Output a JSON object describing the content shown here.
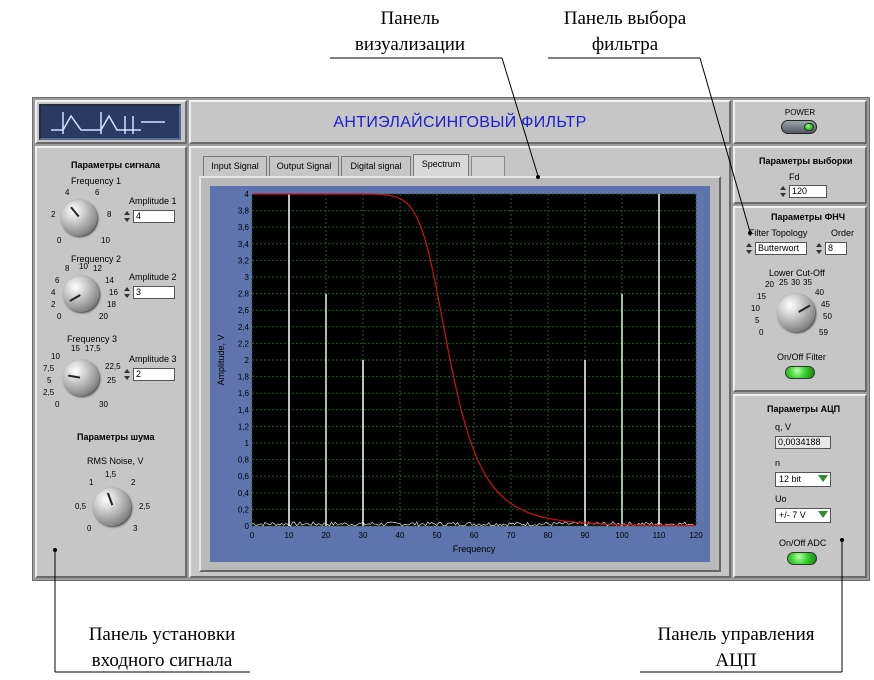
{
  "callouts": {
    "visualization": [
      "Панель",
      "визуализации"
    ],
    "filter_select": [
      "Панель выбора",
      "фильтра"
    ],
    "input_signal": [
      "Панель установки",
      "входного сигнала"
    ],
    "adc_control": [
      "Панель  управления",
      "АЦП"
    ]
  },
  "header": {
    "title": "АНТИЭЛАЙСИНГОВЫЙ ФИЛЬТР",
    "power_label": "POWER"
  },
  "signal_panel": {
    "title": "Параметры  сигнала",
    "freq1": {
      "label": "Frequency 1",
      "ticks": [
        "0",
        "2",
        "4",
        "6",
        "8",
        "10"
      ],
      "amp_label": "Amplitude 1",
      "amp_value": "4"
    },
    "freq2": {
      "label": "Frequency 2",
      "ticks": [
        "0",
        "2",
        "4",
        "6",
        "8",
        "10",
        "12",
        "14",
        "16",
        "18",
        "20"
      ],
      "amp_label": "Amplitude 2",
      "amp_value": "3"
    },
    "freq3": {
      "label": "Frequency 3",
      "ticks": [
        "0",
        "2,5",
        "5",
        "7,5",
        "10",
        "15",
        "17,5",
        "22,5",
        "25",
        "30"
      ],
      "amp_label": "Amplitude 3",
      "amp_value": "2"
    },
    "noise_title": "Параметры шума",
    "noise": {
      "label": "RMS Noise, V",
      "ticks": [
        "0",
        "0,5",
        "1",
        "1,5",
        "2",
        "2,5",
        "3"
      ]
    }
  },
  "tabs": [
    {
      "label": "Input Signal",
      "active": false
    },
    {
      "label": "Output Signal",
      "active": false
    },
    {
      "label": "Digital signal",
      "active": false
    },
    {
      "label": "Spectrum",
      "active": true
    }
  ],
  "chart_data": {
    "type": "line",
    "xlabel": "Frequency",
    "ylabel": "Amplitude, V",
    "xlim": [
      0,
      120
    ],
    "ylim": [
      0,
      4
    ],
    "xticks": [
      0,
      10,
      20,
      30,
      40,
      50,
      60,
      70,
      80,
      90,
      100,
      110,
      120
    ],
    "yticks": [
      0,
      0.2,
      0.4,
      0.6,
      0.8,
      1,
      1.2,
      1.4,
      1.6,
      1.8,
      2,
      2.2,
      2.4,
      2.6,
      2.8,
      3,
      3.2,
      3.4,
      3.6,
      3.8,
      4
    ],
    "ytick_labels": [
      "0",
      "0,2",
      "0,4",
      "0,6",
      "0,8",
      "1",
      "1,2",
      "1,4",
      "1,6",
      "1,8",
      "2",
      "2,2",
      "2,4",
      "2,6",
      "2,8",
      "3",
      "3,2",
      "3,4",
      "3,6",
      "3,8",
      "4"
    ],
    "grid": true,
    "spectrum_lines": [
      {
        "x": 10,
        "y": 4.0,
        "color": "#ffffff"
      },
      {
        "x": 20,
        "y": 2.8,
        "color": "#d8ffd8"
      },
      {
        "x": 30,
        "y": 2.0,
        "color": "#ffffff"
      },
      {
        "x": 90,
        "y": 2.0,
        "color": "#ffffff"
      },
      {
        "x": 100,
        "y": 2.8,
        "color": "#d8ffd8"
      },
      {
        "x": 110,
        "y": 4.0,
        "color": "#ffffff"
      }
    ],
    "filter_curve": {
      "color": "#d01010",
      "level": 4.0,
      "cutoff": 50,
      "order": 8
    },
    "colors": {
      "plot_bg": "#000000",
      "grid": "#1e5e1e",
      "frame": "#5f74ad"
    }
  },
  "sampling_panel": {
    "title": "Параметры выборки",
    "fd_label": "Fd",
    "fd_value": "120"
  },
  "lpf_panel": {
    "title": "Параметры ФНЧ",
    "topology_label": "Filter Topology",
    "topology_value": "Butterwort",
    "order_label": "Order",
    "order_value": "8",
    "cutoff_label": "Lower Cut-Off",
    "cutoff_ticks": [
      "0",
      "5",
      "10",
      "15",
      "20",
      "25",
      "30",
      "35",
      "40",
      "45",
      "50",
      "59"
    ],
    "onoff_label": "On/Off Filter"
  },
  "adc_panel": {
    "title": "Параметры АЦП",
    "q_label": "q, V",
    "q_value": "0,0034188",
    "n_label": "n",
    "n_value": "12 bit",
    "uo_label": "Uo",
    "uo_value": "+/- 7 V",
    "onoff_label": "On/Off ADC"
  }
}
